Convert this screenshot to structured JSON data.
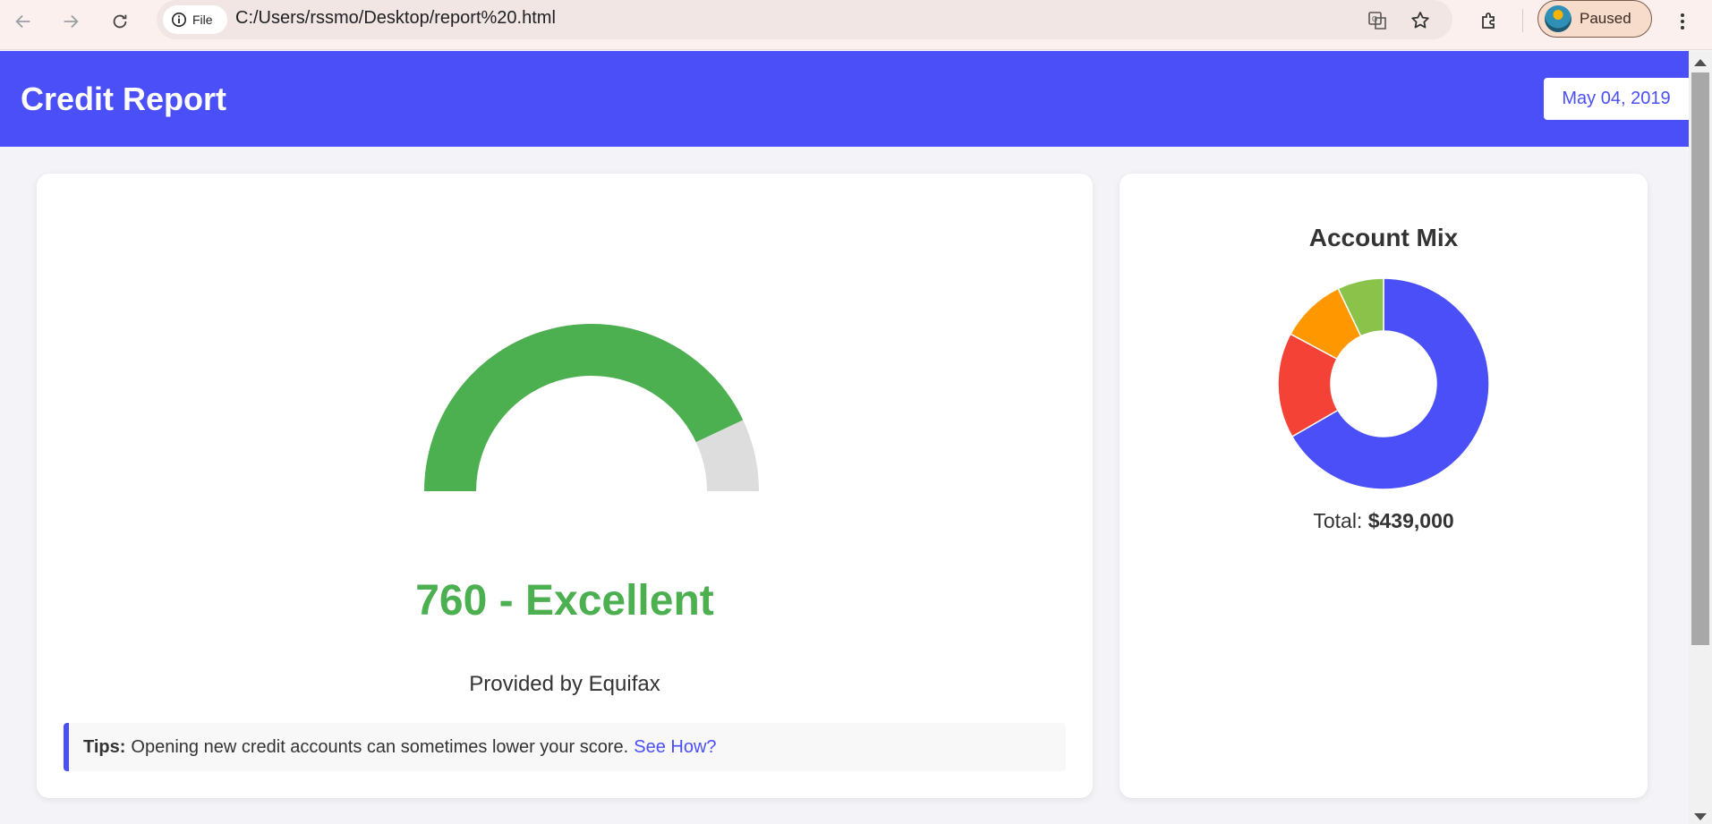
{
  "browser": {
    "site_chip_label": "File",
    "url": "C:/Users/rssmo/Desktop/report%20.html",
    "profile_label": "Paused"
  },
  "header": {
    "title": "Credit Report",
    "date": "May 04, 2019"
  },
  "score_card": {
    "score_text": "760 - Excellent",
    "gauge_fraction": 0.86,
    "gauge_color": "#4caf50",
    "gauge_track_color": "#dddddd",
    "provider": "Provided by Equifax",
    "tips_label": "Tips:",
    "tips_text": "Opening new credit accounts can sometimes lower your score.",
    "tips_link": "See How?"
  },
  "mix_card": {
    "title": "Account Mix",
    "total_label": "Total:",
    "total_value": "$439,000"
  },
  "chart_data": {
    "type": "pie",
    "title": "Account Mix",
    "values": [
      66,
      16,
      10,
      7
    ],
    "colors": [
      "#4a4ff7",
      "#f44336",
      "#ff9800",
      "#8bc34a"
    ]
  },
  "colors": {
    "accent": "#4a4ff7",
    "success": "#4caf50"
  }
}
